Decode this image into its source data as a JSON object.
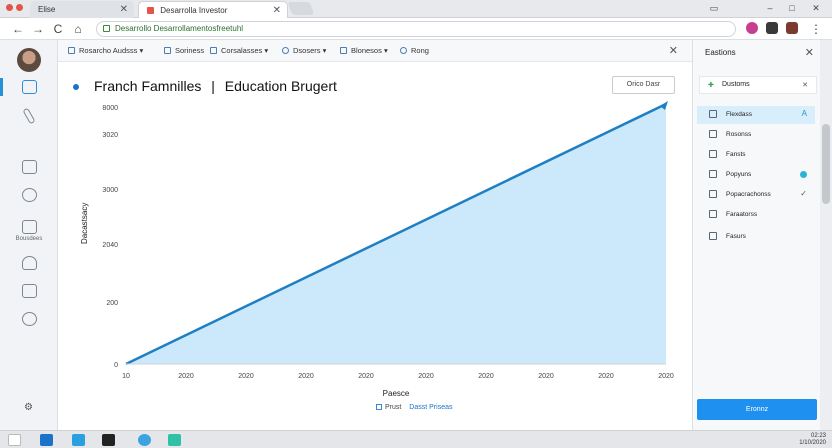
{
  "browser": {
    "tab_inactive_label": "Elise",
    "tab_active_label": "Desarrolla Investor",
    "url": "Desarrollo Desarrollamentosfreetuhl",
    "colors": {
      "accent": "#2b8fd6",
      "fill": "#cbe9fb",
      "line": "#1f7fc2",
      "button": "#1e90f0"
    }
  },
  "toolbar": {
    "items": [
      {
        "label": "Rosarcho Audsss",
        "icon": "grid-icon",
        "has_dropdown": true
      },
      {
        "label": "Soriness",
        "icon": "page-icon",
        "has_dropdown": false
      },
      {
        "label": "Corsalasses",
        "icon": "table-icon",
        "has_dropdown": true
      },
      {
        "label": "Dsosers",
        "icon": "clock-icon",
        "has_dropdown": true
      },
      {
        "label": "Blonesos",
        "icon": "doc-icon",
        "has_dropdown": true
      },
      {
        "label": "Rong",
        "icon": "gear-icon",
        "has_dropdown": false
      }
    ]
  },
  "rail": {
    "items": [
      "profile",
      "chat-icon",
      "edit-icon",
      "doc-icon",
      "info-icon",
      "chart-icon",
      "share-icon",
      "message-icon",
      "help-icon"
    ],
    "label": "Bousdees"
  },
  "chart": {
    "title_left": "Franch Famnilles",
    "title_right": "Education Brugert",
    "action_label": "Orico Dasr",
    "ylabel": "Dacastsacy",
    "xlabel": "Paesce",
    "legend_label": "Prust",
    "legend_link": "Dasst Priseas"
  },
  "chart_data": {
    "type": "area",
    "title": "Franch Famnilles | Education Brugert",
    "xlabel": "Paesce",
    "ylabel": "Dacastsacy",
    "x_ticks": [
      "10",
      "2020",
      "2020",
      "2020",
      "2020",
      "2020",
      "2020",
      "2020",
      "2020",
      "2020"
    ],
    "y_ticks": [
      "0",
      "200",
      "2040",
      "3000",
      "3020",
      "8000"
    ],
    "series": [
      {
        "values": [
          0,
          5000
        ],
        "x": [
          0,
          9
        ]
      }
    ],
    "ylim": [
      0,
      5000
    ],
    "grid": false,
    "legend": "bottom-center"
  },
  "side": {
    "title": "Eastions",
    "section_label": "Dustoms",
    "items": [
      {
        "label": "Flexdass",
        "icon": "pencil-icon",
        "mark": "A",
        "selected": true
      },
      {
        "label": "Rosonss",
        "icon": "image-icon",
        "mark": "",
        "selected": false
      },
      {
        "label": "Fansts",
        "icon": "box-icon",
        "mark": "",
        "selected": false
      },
      {
        "label": "Popyuns",
        "icon": "tablet-icon",
        "mark": "dot",
        "selected": false
      },
      {
        "label": "Popacrachonss",
        "icon": "monitor-icon",
        "mark": "check",
        "selected": false
      },
      {
        "label": "Faraatorss",
        "icon": "edit-icon",
        "mark": "",
        "selected": false
      },
      {
        "label": "Fasurs",
        "icon": "calendar-icon",
        "mark": "",
        "selected": false
      }
    ],
    "button_label": "Eronnz"
  },
  "taskbar": {
    "time": "02:23",
    "date": "1/10/2020"
  }
}
